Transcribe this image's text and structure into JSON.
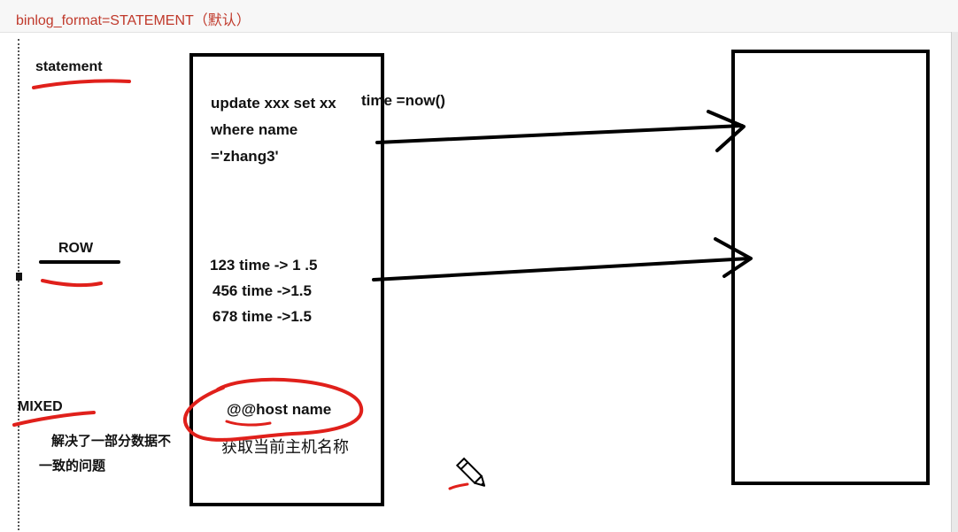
{
  "header": {
    "title": "binlog_format=STATEMENT（默认）"
  },
  "labels": {
    "statement": "statement",
    "row": "ROW",
    "mixed": "MIXED",
    "mixed_note_line1": "解决了一部分数据不",
    "mixed_note_line2": "一致的问题"
  },
  "middle_box": {
    "statement_sql_line1": "update xxx set xx",
    "statement_sql_line1b": "time =now()",
    "statement_sql_line2": "where name",
    "statement_sql_line3": "='zhang3'",
    "row_lines": [
      "123    time -> 1 .5",
      "456   time  ->1.5",
      "678  time ->1.5"
    ],
    "host_variable": "@@host  name",
    "host_note": "获取当前主机名称"
  },
  "icons": {
    "pointer": "pencil-icon"
  },
  "colors": {
    "ink_red": "#e0201b",
    "ink_black": "#000000",
    "title_red": "#c0392b"
  }
}
